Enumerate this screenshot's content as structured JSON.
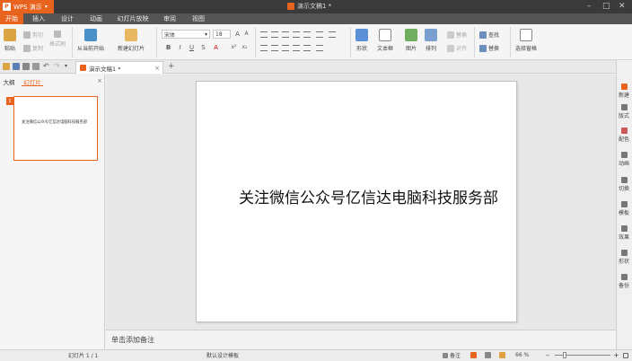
{
  "app": {
    "name": "WPS 演示",
    "doc_title": "演示文稿1 *"
  },
  "menu": [
    "开始",
    "插入",
    "设计",
    "动画",
    "幻灯片放映",
    "审阅",
    "视图"
  ],
  "ribbon": {
    "paste": "粘贴",
    "cut": "剪切",
    "copy": "复制",
    "format_painter": "格式刷",
    "from_current": "从当前开始",
    "new_slide": "新建幻灯片",
    "font_name": "宋体",
    "font_size": "18",
    "shape": "形状",
    "textbox": "文本框",
    "picture": "图片",
    "arrange": "排列",
    "replace_left": "替换",
    "align": "对齐",
    "find": "查找",
    "replace": "替换",
    "select_pane": "选择窗格"
  },
  "doc_tab": {
    "title": "演示文稿1 *",
    "new_tab": "+"
  },
  "left_panel": {
    "tab_outline": "大纲",
    "tab_slides": "幻灯片",
    "thumb_num": "1",
    "thumb_text": "关注微信公众号亿信达电脑科技服务部"
  },
  "slide": {
    "text": "关注微信公众号亿信达电脑科技服务部"
  },
  "notes": {
    "placeholder": "单击添加备注"
  },
  "right_pane": [
    "新建",
    "版式",
    "配色",
    "动画",
    "切换",
    "模板",
    "效果",
    "形状",
    "备份"
  ],
  "status": {
    "slide_count": "幻灯片 1 / 1",
    "template": "默认设计模板",
    "notes_toggle": "备注",
    "zoom": "66 %"
  },
  "colors": {
    "accent": "#e8631e",
    "titlebar": "#3a3a3a",
    "menubar": "#555555"
  }
}
